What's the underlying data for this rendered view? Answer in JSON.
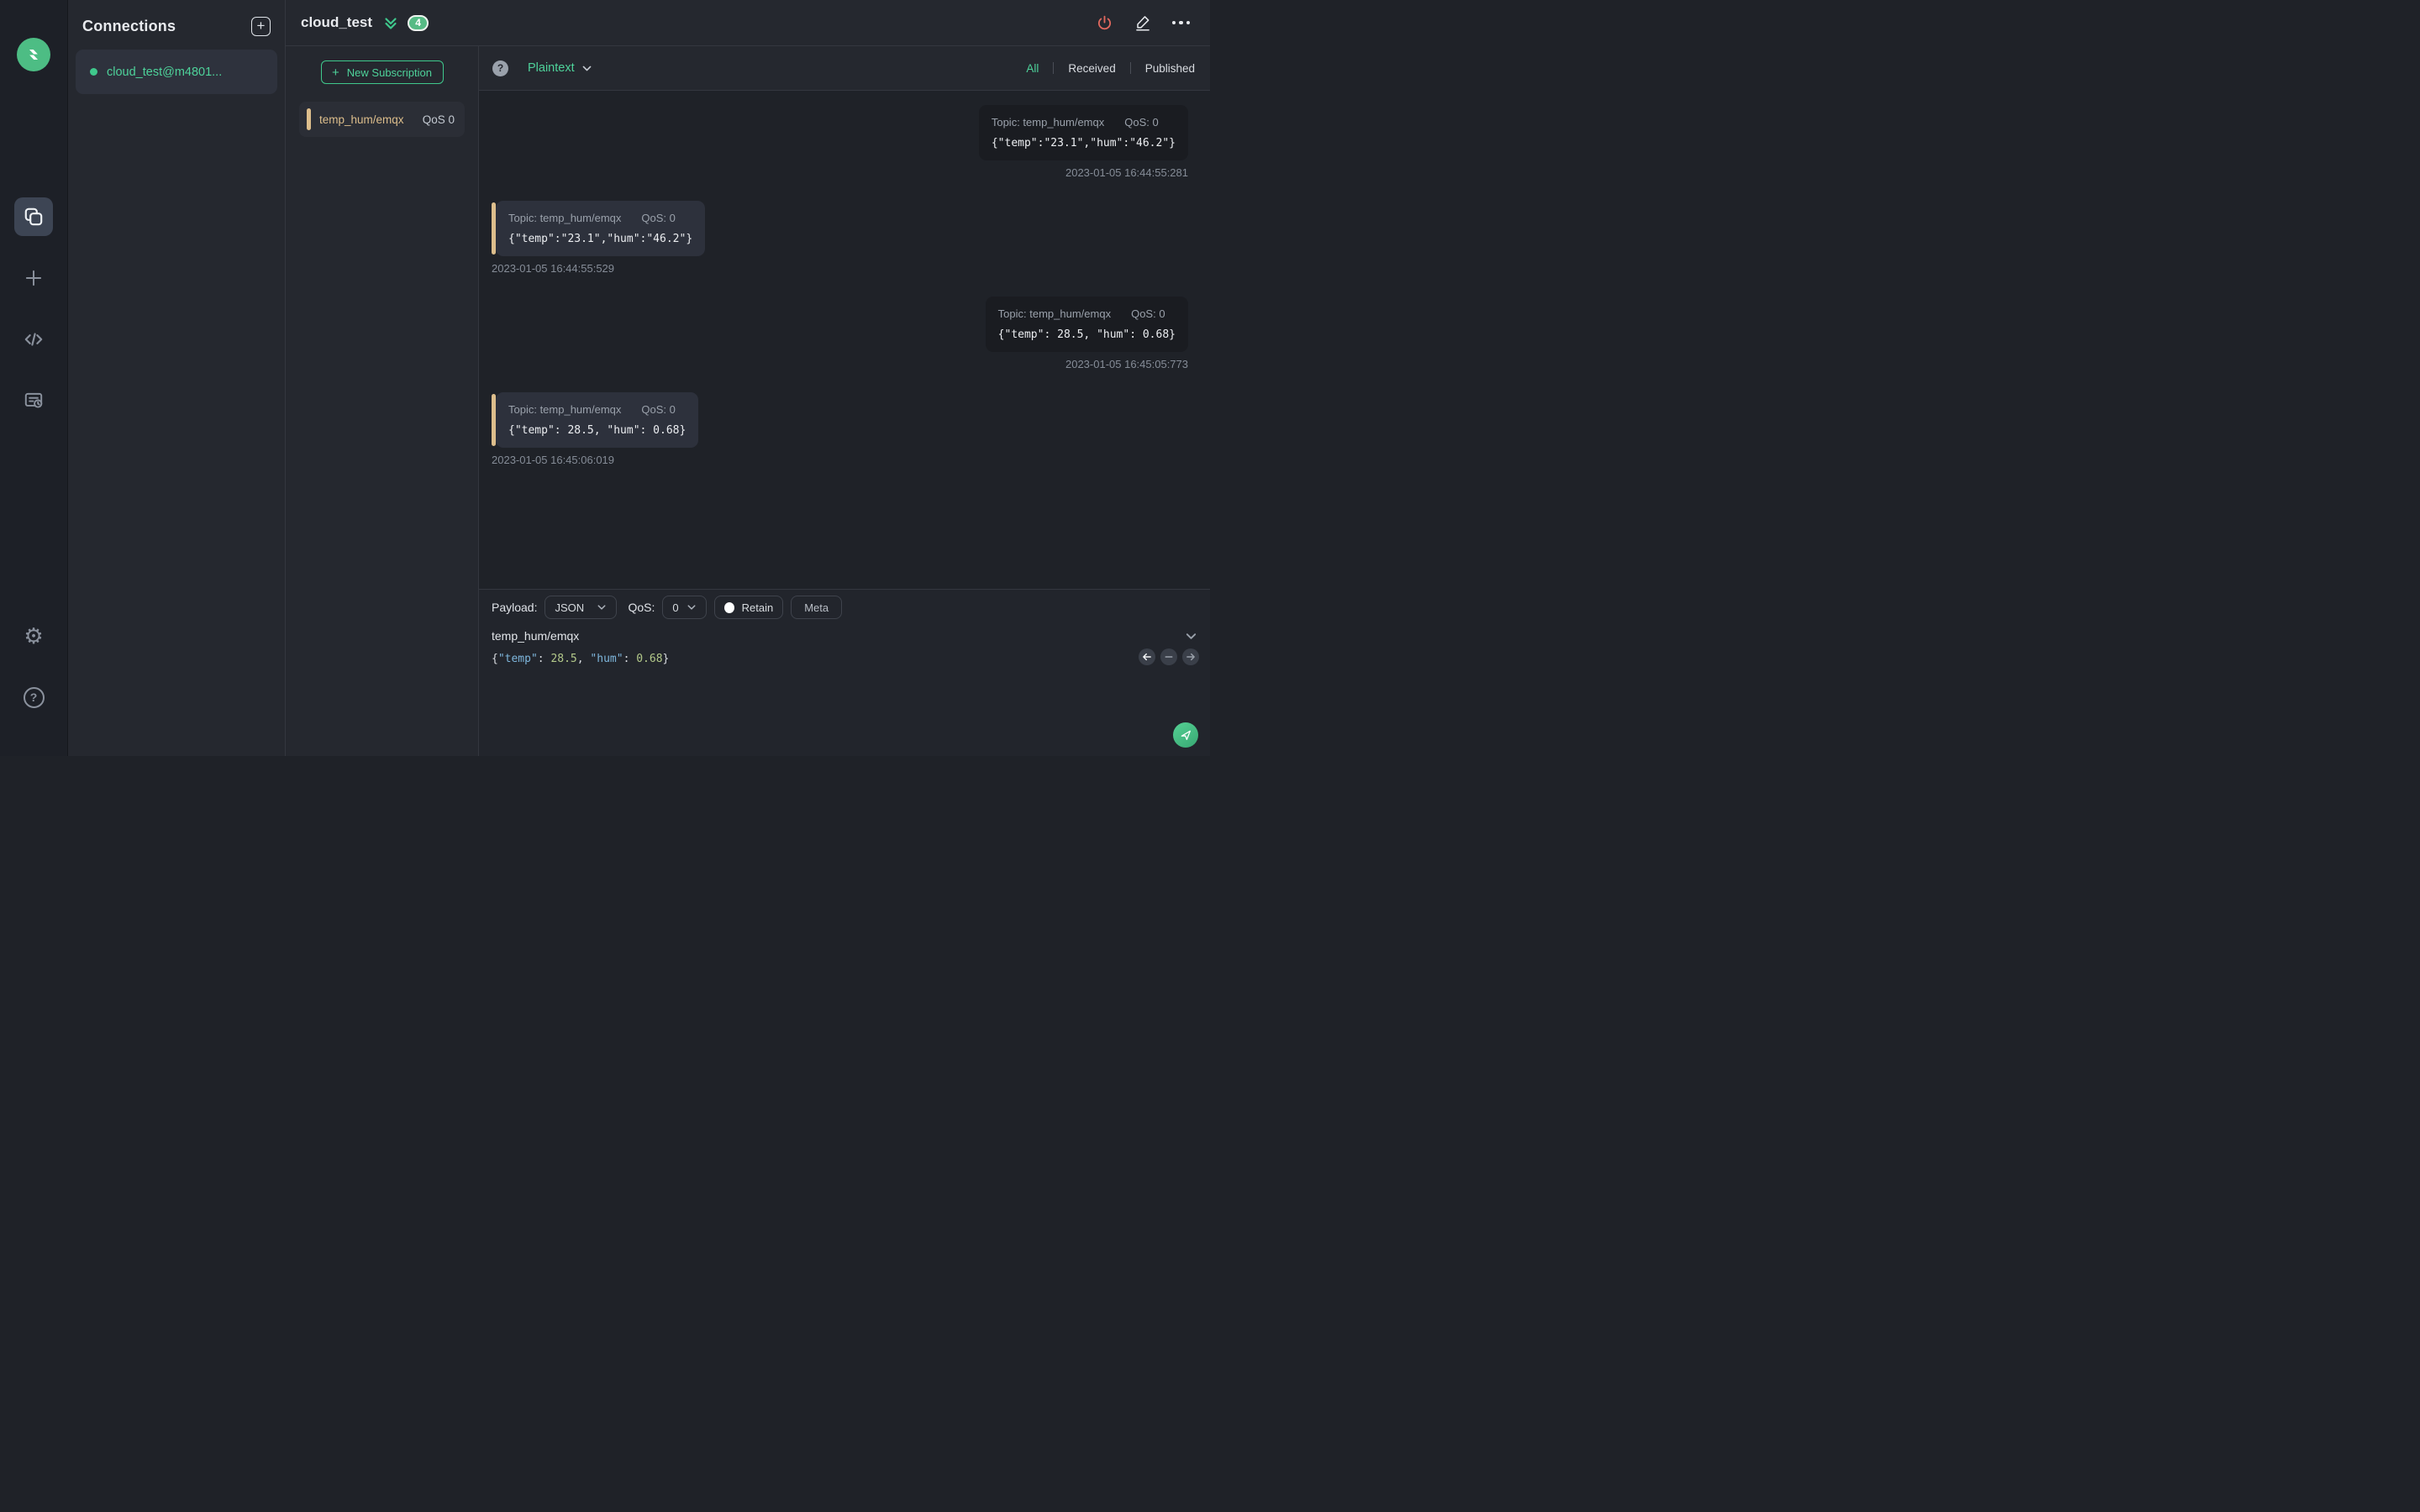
{
  "colors": {
    "accent_green": "#3fc88c",
    "subscription_tan": "#ddbe8c",
    "disconnect_red": "#e0685e"
  },
  "rail_icons": [
    "mqttx-logo",
    "connections",
    "new-connection",
    "script",
    "log",
    "settings",
    "help"
  ],
  "connections_panel": {
    "title": "Connections",
    "items": [
      {
        "name": "cloud_test@m4801...",
        "status": "connected"
      }
    ]
  },
  "header": {
    "title": "cloud_test",
    "badge_count": "4"
  },
  "subscriptions": {
    "new_button_label": "New Subscription",
    "new_button_plus": "+",
    "items": [
      {
        "topic": "temp_hum/emqx",
        "qos": "QoS 0"
      }
    ]
  },
  "messages_toolbar": {
    "help": "?",
    "format_value": "Plaintext",
    "filters": {
      "all": "All",
      "received": "Received",
      "published": "Published",
      "active": "All"
    }
  },
  "messages": [
    {
      "direction": "published",
      "topic": "Topic: temp_hum/emqx",
      "qos": "QoS: 0",
      "payload": "{\"temp\":\"23.1\",\"hum\":\"46.2\"}",
      "timestamp": "2023-01-05 16:44:55:281"
    },
    {
      "direction": "received",
      "topic": "Topic: temp_hum/emqx",
      "qos": "QoS: 0",
      "payload": "{\"temp\":\"23.1\",\"hum\":\"46.2\"}",
      "timestamp": "2023-01-05 16:44:55:529"
    },
    {
      "direction": "published",
      "topic": "Topic: temp_hum/emqx",
      "qos": "QoS: 0",
      "payload": "{\"temp\": 28.5, \"hum\": 0.68}",
      "timestamp": "2023-01-05 16:45:05:773"
    },
    {
      "direction": "received",
      "topic": "Topic: temp_hum/emqx",
      "qos": "QoS: 0",
      "payload": "{\"temp\": 28.5, \"hum\": 0.68}",
      "timestamp": "2023-01-05 16:45:06:019"
    }
  ],
  "publish": {
    "payload_label": "Payload:",
    "format_value": "JSON",
    "qos_label": "QoS:",
    "qos_value": "0",
    "retain_label": "Retain",
    "meta_label": "Meta",
    "topic_value": "temp_hum/emqx",
    "editor_tokens": {
      "open": "{",
      "key1": "\"temp\"",
      "sep1": ": ",
      "num1": "28.5",
      "comma": ", ",
      "key2": "\"hum\"",
      "sep2": ": ",
      "num2": "0.68",
      "close": "}"
    }
  }
}
